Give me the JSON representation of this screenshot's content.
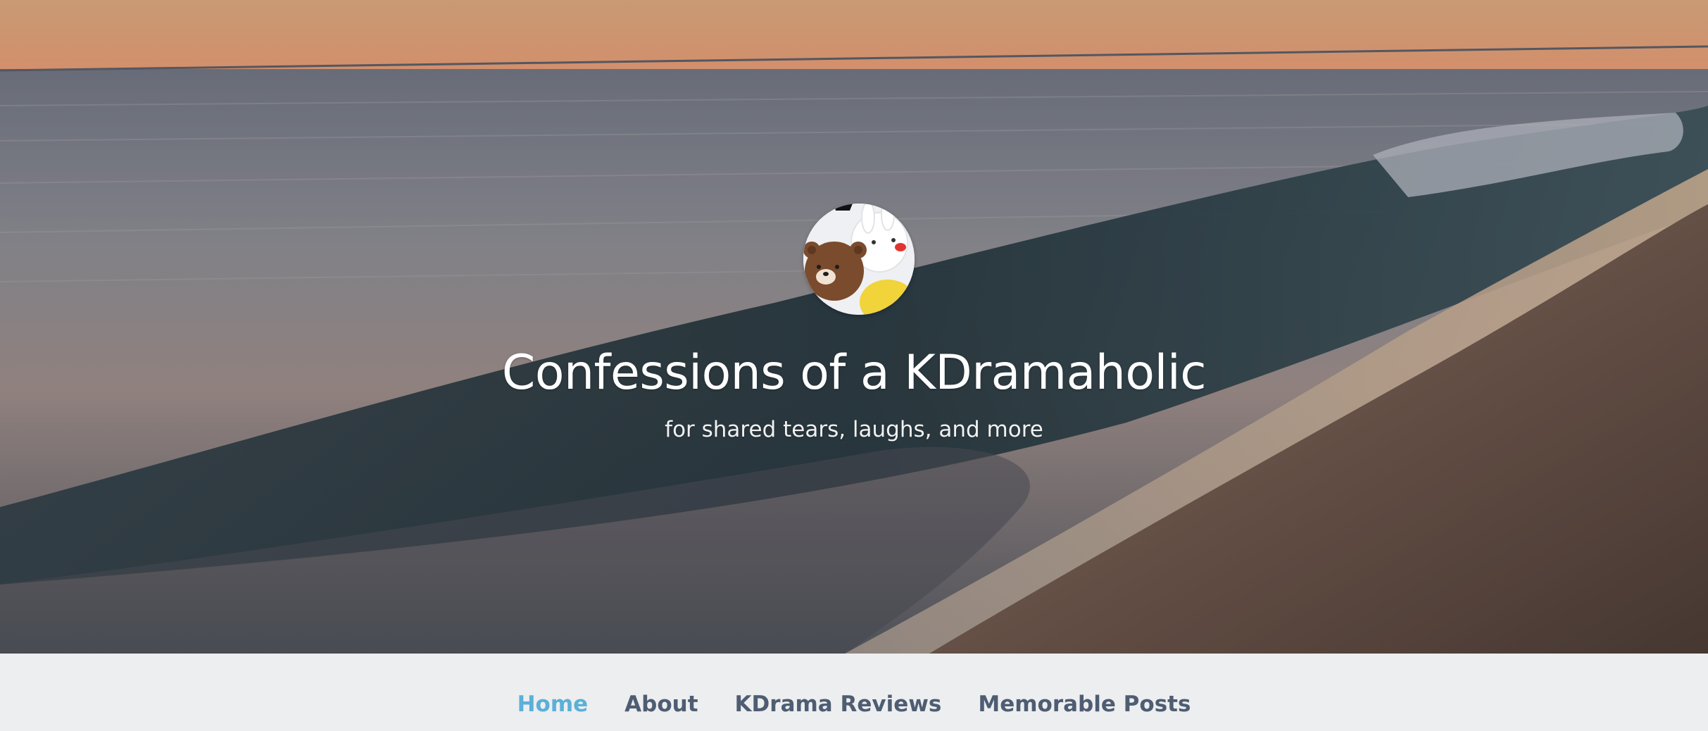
{
  "header": {
    "title": "Confessions of a KDramaholic",
    "tagline": "for shared tears, laughs, and more"
  },
  "nav": {
    "items": [
      {
        "label": "Home",
        "active": true
      },
      {
        "label": "About",
        "active": false
      },
      {
        "label": "KDrama Reviews",
        "active": false
      },
      {
        "label": "Memorable Posts",
        "active": false
      }
    ]
  },
  "colors": {
    "nav_background": "#edeef0",
    "nav_text": "#4e5d72",
    "nav_active": "#5bb0d8",
    "title_text": "#ffffff"
  },
  "icons": {
    "avatar": "bear-and-bunny-avatar-icon"
  }
}
